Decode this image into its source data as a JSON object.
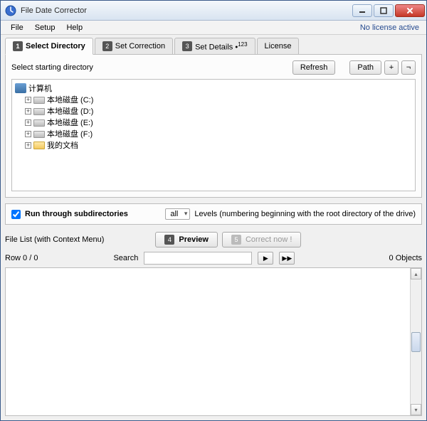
{
  "window": {
    "title": "File Date Corrector"
  },
  "menu": {
    "file": "File",
    "setup": "Setup",
    "help": "Help",
    "license_status": "No license active"
  },
  "tabs": {
    "t1": {
      "num": "1",
      "label": "Select Directory"
    },
    "t2": {
      "num": "2",
      "label": "Set Correction"
    },
    "t3": {
      "num": "3",
      "label": "Set Details •",
      "sup": "123"
    },
    "t4": {
      "label": "License"
    }
  },
  "directory": {
    "heading": "Select starting directory",
    "refresh": "Refresh",
    "path": "Path",
    "plus": "+",
    "toggle": "¬",
    "tree": {
      "root": "计算机",
      "drives": [
        "本地磁盘 (C:)",
        "本地磁盘 (D:)",
        "本地磁盘 (E:)",
        "本地磁盘 (F:)"
      ],
      "docs": "我的文档"
    }
  },
  "subdir": {
    "checkbox_label": "Run through subdirectories",
    "checked": true,
    "level_value": "all",
    "level_text": "Levels  (numbering beginning with the root directory of the drive)"
  },
  "filelist_label": "File List (with Context Menu)",
  "preview": {
    "num": "4",
    "label": "Preview"
  },
  "correct": {
    "num": "5",
    "label": "Correct now !"
  },
  "search": {
    "row_label": "Row 0 / 0",
    "label": "Search",
    "value": "",
    "objects": "0 Objects"
  }
}
